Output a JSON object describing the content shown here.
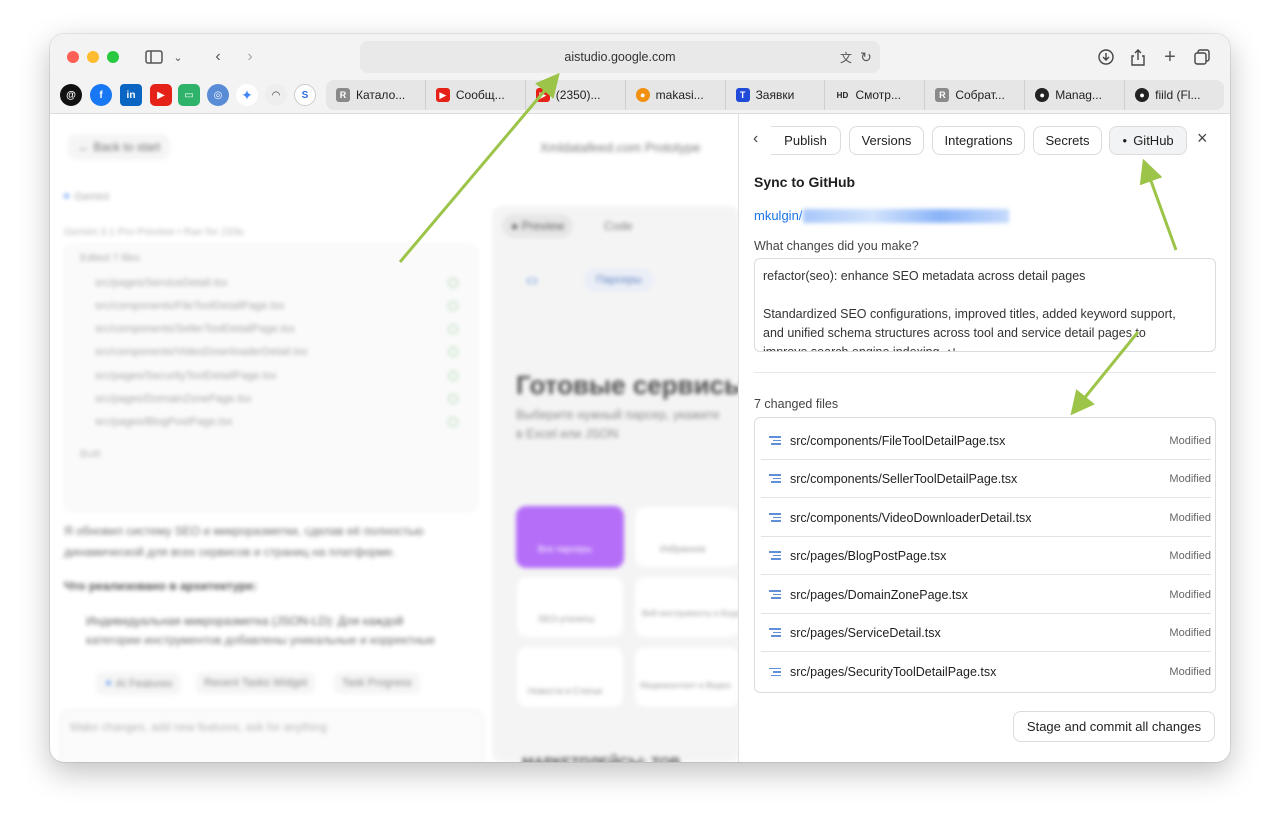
{
  "browser": {
    "address": "aistudio.google.com",
    "bookmark_tabs": [
      {
        "label": "Катало...",
        "icon": "R",
        "color": "#8a8a8a"
      },
      {
        "label": "Сообщ...",
        "icon": "▶",
        "color": "#e62117"
      },
      {
        "label": "(2350)...",
        "icon": "▶",
        "color": "#e62117"
      },
      {
        "label": "makasi...",
        "icon": "●",
        "color": "#f29111"
      },
      {
        "label": "Заявки",
        "icon": "T",
        "color": "#1f4bd8"
      },
      {
        "label": "Смотр...",
        "icon": "HD",
        "color": "#222222"
      },
      {
        "label": "Собрат...",
        "icon": "R",
        "color": "#8a8a8a"
      },
      {
        "label": "Manag...",
        "icon": "●",
        "color": "#222222"
      },
      {
        "label": "fiild (Fl...",
        "icon": "●",
        "color": "#222222"
      }
    ]
  },
  "background_app": {
    "back_label": "Back to start",
    "project_title": "Xmldatafeed.com Prototype",
    "model_label": "Gemini",
    "run_info": "Gemini 3.1 Pro Preview • Ran for 233s",
    "edited_label": "Edited 7 files",
    "edited_files": [
      "src/pages/ServiceDetail.tsx",
      "src/components/FileToolDetailPage.tsx",
      "src/components/SellerToolDetailPage.tsx",
      "src/components/VideoDownloaderDetail.tsx",
      "src/pages/SecurityToolDetailPage.tsx",
      "src/pages/DomainZonePage.tsx",
      "src/pages/BlogPostPage.tsx"
    ],
    "built_label": "Built",
    "message_1": "Я обновил систему SEO и микроразметки, сделав её полностью",
    "message_2": "динамической для всех сервисов и страниц на платформе.",
    "section_head": "Что реализовано в архитектуре:",
    "bullet_1": "Индивидуальная микроразметка (JSON-LD): Для каждой",
    "bullet_2": "категории инструментов добавлены уникальные и корректные",
    "chips": [
      "AI Features",
      "Recent Tasks Widget",
      "Task Progress"
    ],
    "prompt_placeholder": "Make changes, add new features, ask for anything",
    "preview_tab": "Preview",
    "code_tab": "Code",
    "nav_pill": "Парсеры",
    "hero_title": "Готовые сервисы",
    "hero_sub_1": "Выберите нужный парсер, укажите",
    "hero_sub_2": "в Excel или JSON",
    "card_all": "Все парсеры",
    "card_fav": "Избранное",
    "card_seo": "SEO-утилиты",
    "card_web": "Веб-инструменты и Боды",
    "card_news": "Новости и Статьи",
    "card_media": "Медиаконтент и Видео",
    "market_title": "МАРКЕТПЛЕЙСЫ: ТОВ"
  },
  "panel": {
    "tabs": [
      "Publish",
      "Versions",
      "Integrations",
      "Secrets",
      "GitHub"
    ],
    "active_tab": "GitHub",
    "title": "Sync to GitHub",
    "repo_owner": "mkulgin/",
    "changes_label": "What changes did you make?",
    "commit_message": {
      "summary": "refactor(seo): enhance SEO metadata across detail pages",
      "body_1": "Standardized SEO configurations, improved titles, added keyword support,",
      "body_2": "and unified schema structures across tool and service detail pages to",
      "body_3": "improve search engine indexing. ↵"
    },
    "changed_count": "7 changed files",
    "files": [
      {
        "name": "src/components/FileToolDetailPage.tsx",
        "status": "Modified"
      },
      {
        "name": "src/components/SellerToolDetailPage.tsx",
        "status": "Modified"
      },
      {
        "name": "src/components/VideoDownloaderDetail.tsx",
        "status": "Modified"
      },
      {
        "name": "src/pages/BlogPostPage.tsx",
        "status": "Modified"
      },
      {
        "name": "src/pages/DomainZonePage.tsx",
        "status": "Modified"
      },
      {
        "name": "src/pages/ServiceDetail.tsx",
        "status": "Modified"
      },
      {
        "name": "src/pages/SecurityToolDetailPage.tsx",
        "status": "Modified"
      }
    ],
    "commit_button": "Stage and commit all changes"
  },
  "colors": {
    "arrow": "#9bc448",
    "link": "#1a73e8",
    "accent_purple": "#a855f7"
  }
}
